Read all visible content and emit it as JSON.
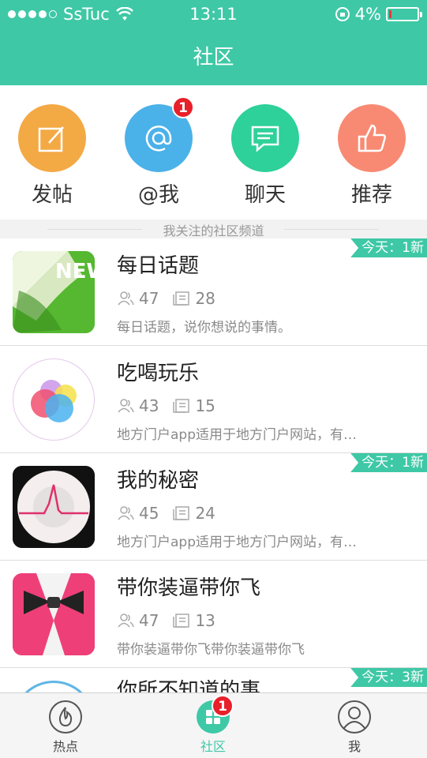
{
  "status": {
    "carrier": "SsTuc",
    "time": "13:11",
    "battery": "4%",
    "battery_level": 0.04
  },
  "nav": {
    "title": "社区"
  },
  "actions": [
    {
      "label": "发帖",
      "color": "#f3a944",
      "icon": "compose-icon"
    },
    {
      "label": "@我",
      "color": "#4bb1e9",
      "icon": "at-icon",
      "badge": "1"
    },
    {
      "label": "聊天",
      "color": "#2ed199",
      "icon": "chat-icon"
    },
    {
      "label": "推荐",
      "color": "#f88a73",
      "icon": "thumbs-up-icon"
    }
  ],
  "section": {
    "title": "我关注的社区频道"
  },
  "channels": [
    {
      "name": "每日话题",
      "members": "47",
      "posts": "28",
      "desc": "每日话题，说你想说的事情。",
      "today": "今天：1新",
      "thumb_text": "NEW"
    },
    {
      "name": "吃喝玩乐",
      "members": "43",
      "posts": "15",
      "desc": "地方门户app适用于地方门户网站，有…",
      "today": ""
    },
    {
      "name": "我的秘密",
      "members": "45",
      "posts": "24",
      "desc": "地方门户app适用于地方门户网站，有…",
      "today": "今天：1新"
    },
    {
      "name": "带你装逼带你飞",
      "members": "47",
      "posts": "13",
      "desc": "带你装逼带你飞带你装逼带你飞",
      "today": ""
    },
    {
      "name": "你所不知道的事",
      "members": "",
      "posts": "",
      "desc": "",
      "today": "今天：3新"
    }
  ],
  "tabs": [
    {
      "label": "热点",
      "icon": "flame-icon"
    },
    {
      "label": "社区",
      "icon": "community-icon",
      "badge": "1",
      "active": true
    },
    {
      "label": "我",
      "icon": "profile-icon"
    }
  ],
  "colors": {
    "accent": "#3ec8a6",
    "badge": "#e8202a"
  }
}
